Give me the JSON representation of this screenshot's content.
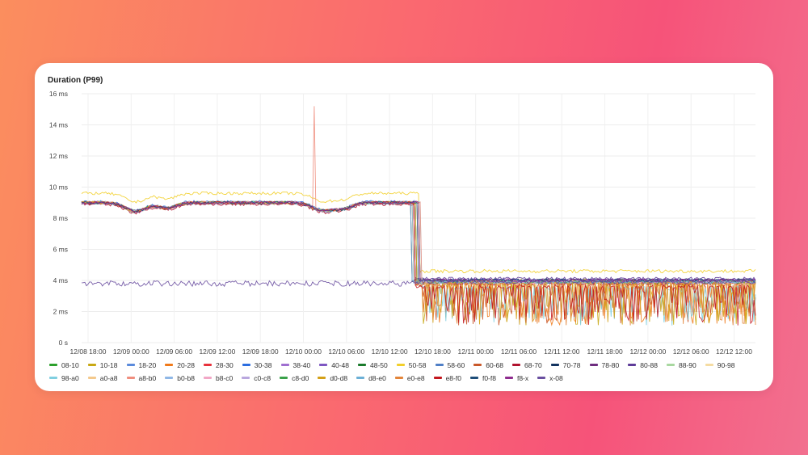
{
  "panel": {
    "title": "Duration (P99)"
  },
  "chart_data": {
    "type": "line",
    "title": "Duration (P99)",
    "ylim": [
      0,
      16
    ],
    "y_ticks": [
      "0 s",
      "2 ms",
      "4 ms",
      "6 ms",
      "8 ms",
      "10 ms",
      "12 ms",
      "14 ms",
      "16 ms"
    ],
    "x_ticks": [
      "12/08 18:00",
      "12/09 00:00",
      "12/09 06:00",
      "12/09 12:00",
      "12/09 18:00",
      "12/10 00:00",
      "12/10 06:00",
      "12/10 12:00",
      "12/10 18:00",
      "12/11 00:00",
      "12/11 06:00",
      "12/11 12:00",
      "12/11 18:00",
      "12/12 00:00",
      "12/12 06:00",
      "12/12 12:00"
    ],
    "grid": true,
    "legend_position": "bottom",
    "series": [
      {
        "name": "08-10",
        "color": "#2ca02c",
        "before": 9.0,
        "after": 3.9,
        "low": false
      },
      {
        "name": "10-18",
        "color": "#c8a814",
        "before": 9.0,
        "after": 4.0,
        "low": true
      },
      {
        "name": "18-20",
        "color": "#5b8bdc",
        "before": 9.0,
        "after": 3.9,
        "low": false
      },
      {
        "name": "20-28",
        "color": "#f07a1a",
        "before": 9.0,
        "after": 3.8,
        "low": true
      },
      {
        "name": "28-30",
        "color": "#e8323c",
        "before": 9.0,
        "after": 3.9,
        "low": false
      },
      {
        "name": "30-38",
        "color": "#2b6de0",
        "before": 9.05,
        "after": 4.0,
        "low": false
      },
      {
        "name": "38-40",
        "color": "#9f6fd0",
        "before": 9.0,
        "after": 3.9,
        "low": false
      },
      {
        "name": "40-48",
        "color": "#7e57c2",
        "before": 9.0,
        "after": 4.0,
        "low": false
      },
      {
        "name": "48-50",
        "color": "#1b7b2c",
        "before": 9.0,
        "after": 3.9,
        "low": false
      },
      {
        "name": "50-58",
        "color": "#f2cf2a",
        "before": 9.6,
        "after": 4.6,
        "low": false
      },
      {
        "name": "58-60",
        "color": "#4f7fc6",
        "before": 9.0,
        "after": 3.9,
        "low": false
      },
      {
        "name": "60-68",
        "color": "#c9582a",
        "before": 9.0,
        "after": 3.7,
        "low": true
      },
      {
        "name": "68-70",
        "color": "#b0122e",
        "before": 8.9,
        "after": 3.8,
        "low": false
      },
      {
        "name": "70-78",
        "color": "#12335f",
        "before": 9.0,
        "after": 4.0,
        "low": false
      },
      {
        "name": "78-80",
        "color": "#6e2d7f",
        "before": 9.0,
        "after": 4.0,
        "low": false
      },
      {
        "name": "80-88",
        "color": "#5e3c99",
        "before": 9.0,
        "after": 4.1,
        "low": false
      },
      {
        "name": "88-90",
        "color": "#a8d8a0",
        "before": 9.0,
        "after": 3.9,
        "low": false
      },
      {
        "name": "90-98",
        "color": "#f5dca2",
        "before": 9.0,
        "after": 3.9,
        "low": false
      },
      {
        "name": "98-a0",
        "color": "#80cfe0",
        "before": 9.0,
        "after": 3.5,
        "low": true
      },
      {
        "name": "a0-a8",
        "color": "#f4c98c",
        "before": 9.0,
        "after": 3.9,
        "low": false
      },
      {
        "name": "a8-b0",
        "color": "#f08e7e",
        "before": 9.0,
        "after": 3.9,
        "low": false
      },
      {
        "name": "b0-b8",
        "color": "#8fb7e6",
        "before": 9.0,
        "after": 3.9,
        "low": false
      },
      {
        "name": "b8-c0",
        "color": "#f2a7c6",
        "before": 9.0,
        "after": 3.9,
        "low": false
      },
      {
        "name": "c0-c8",
        "color": "#b9a7de",
        "before": 9.0,
        "after": 3.9,
        "low": false
      },
      {
        "name": "c8-d0",
        "color": "#3aa14a",
        "before": 9.0,
        "after": 3.9,
        "low": false
      },
      {
        "name": "d0-d8",
        "color": "#d4a017",
        "before": 9.0,
        "after": 3.9,
        "low": true
      },
      {
        "name": "d8-e0",
        "color": "#6cb0d6",
        "before": 9.0,
        "after": 3.9,
        "low": false
      },
      {
        "name": "e0-e8",
        "color": "#e3853a",
        "before": 9.0,
        "after": 3.8,
        "low": true
      },
      {
        "name": "e8-f0",
        "color": "#c3181f",
        "before": 9.0,
        "after": 3.6,
        "low": true
      },
      {
        "name": "f0-f8",
        "color": "#1f4e79",
        "before": 9.0,
        "after": 4.0,
        "low": false
      },
      {
        "name": "f8-x",
        "color": "#8e2c8e",
        "before": 9.0,
        "after": 4.0,
        "low": false
      },
      {
        "name": "x-08",
        "color": "#6a4fa0",
        "before": 3.8,
        "after": 3.9,
        "low": false
      }
    ]
  }
}
